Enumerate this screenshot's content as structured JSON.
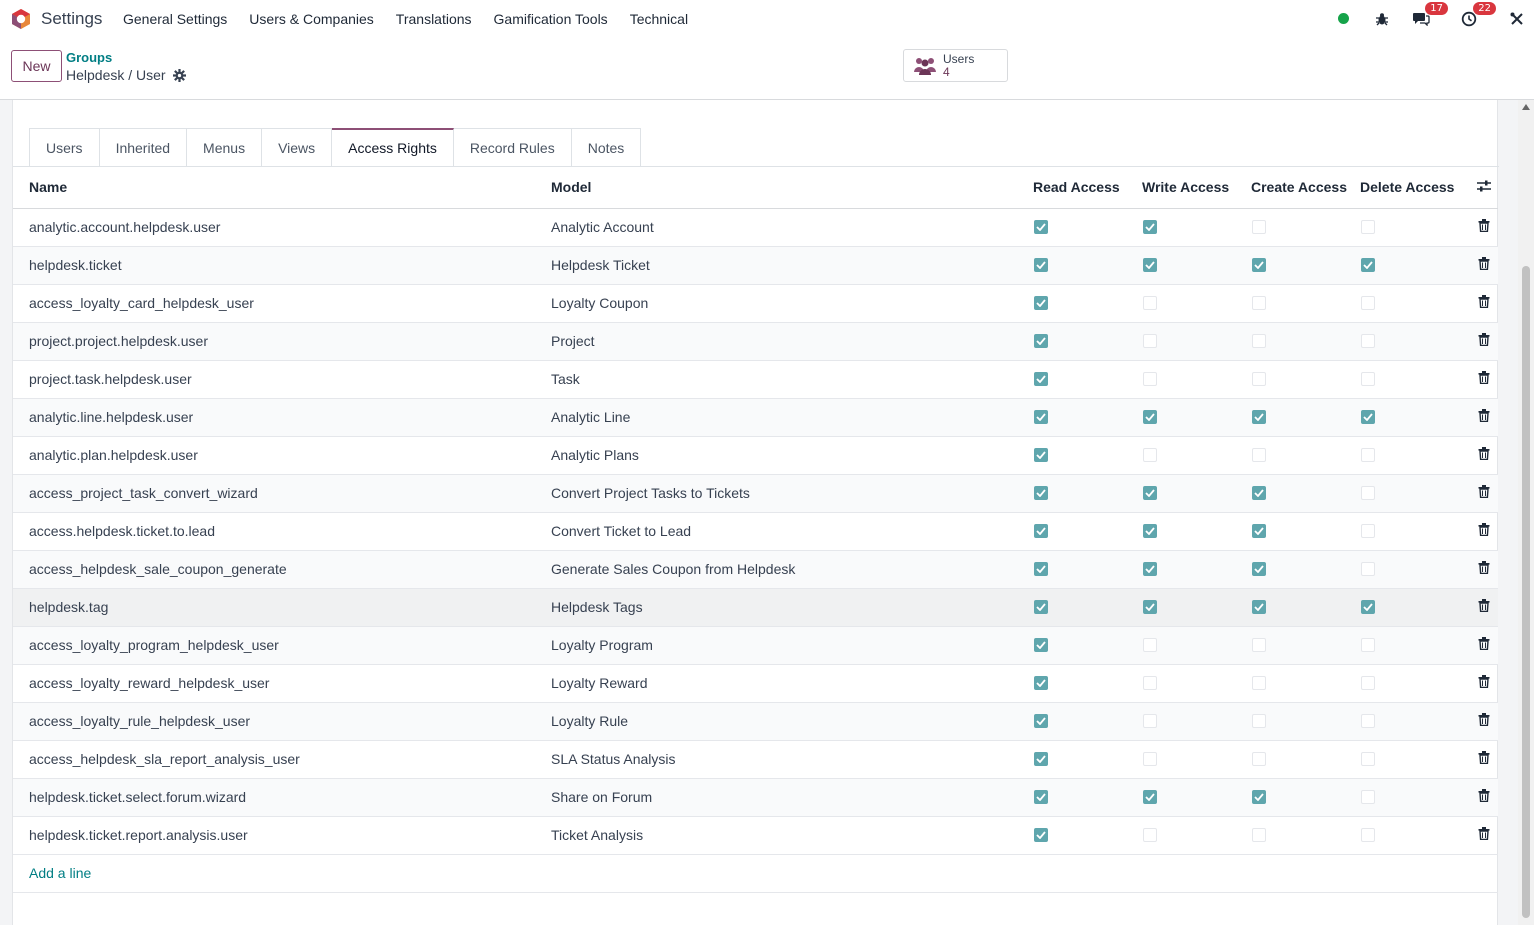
{
  "navbar": {
    "app_name": "Settings",
    "menu": [
      "General Settings",
      "Users & Companies",
      "Translations",
      "Gamification Tools",
      "Technical"
    ],
    "messages_count": "17",
    "activities_count": "22"
  },
  "control_panel": {
    "new_label": "New",
    "breadcrumb_parent": "Groups",
    "breadcrumb_current": "Helpdesk / User",
    "stat_label": "Users",
    "stat_value": "4"
  },
  "tabs": [
    {
      "label": "Users",
      "active": false
    },
    {
      "label": "Inherited",
      "active": false
    },
    {
      "label": "Menus",
      "active": false
    },
    {
      "label": "Views",
      "active": false
    },
    {
      "label": "Access Rights",
      "active": true
    },
    {
      "label": "Record Rules",
      "active": false
    },
    {
      "label": "Notes",
      "active": false
    }
  ],
  "table": {
    "headers": {
      "name": "Name",
      "model": "Model",
      "read": "Read Access",
      "write": "Write Access",
      "create": "Create Access",
      "delete": "Delete Access"
    },
    "rows": [
      {
        "name": "analytic.account.helpdesk.user",
        "model": "Analytic Account",
        "read": true,
        "write": true,
        "create": false,
        "delete": false
      },
      {
        "name": "helpdesk.ticket",
        "model": "Helpdesk Ticket",
        "read": true,
        "write": true,
        "create": true,
        "delete": true
      },
      {
        "name": "access_loyalty_card_helpdesk_user",
        "model": "Loyalty Coupon",
        "read": true,
        "write": false,
        "create": false,
        "delete": false
      },
      {
        "name": "project.project.helpdesk.user",
        "model": "Project",
        "read": true,
        "write": false,
        "create": false,
        "delete": false
      },
      {
        "name": "project.task.helpdesk.user",
        "model": "Task",
        "read": true,
        "write": false,
        "create": false,
        "delete": false
      },
      {
        "name": "analytic.line.helpdesk.user",
        "model": "Analytic Line",
        "read": true,
        "write": true,
        "create": true,
        "delete": true
      },
      {
        "name": "analytic.plan.helpdesk.user",
        "model": "Analytic Plans",
        "read": true,
        "write": false,
        "create": false,
        "delete": false
      },
      {
        "name": "access_project_task_convert_wizard",
        "model": "Convert Project Tasks to Tickets",
        "read": true,
        "write": true,
        "create": true,
        "delete": false
      },
      {
        "name": "access.helpdesk.ticket.to.lead",
        "model": "Convert Ticket to Lead",
        "read": true,
        "write": true,
        "create": true,
        "delete": false
      },
      {
        "name": "access_helpdesk_sale_coupon_generate",
        "model": "Generate Sales Coupon from Helpdesk",
        "read": true,
        "write": true,
        "create": true,
        "delete": false
      },
      {
        "name": "helpdesk.tag",
        "model": "Helpdesk Tags",
        "read": true,
        "write": true,
        "create": true,
        "delete": true
      },
      {
        "name": "access_loyalty_program_helpdesk_user",
        "model": "Loyalty Program",
        "read": true,
        "write": false,
        "create": false,
        "delete": false
      },
      {
        "name": "access_loyalty_reward_helpdesk_user",
        "model": "Loyalty Reward",
        "read": true,
        "write": false,
        "create": false,
        "delete": false
      },
      {
        "name": "access_loyalty_rule_helpdesk_user",
        "model": "Loyalty Rule",
        "read": true,
        "write": false,
        "create": false,
        "delete": false
      },
      {
        "name": "access_helpdesk_sla_report_analysis_user",
        "model": "SLA Status Analysis",
        "read": true,
        "write": false,
        "create": false,
        "delete": false
      },
      {
        "name": "helpdesk.ticket.select.forum.wizard",
        "model": "Share on Forum",
        "read": true,
        "write": true,
        "create": true,
        "delete": false
      },
      {
        "name": "helpdesk.ticket.report.analysis.user",
        "model": "Ticket Analysis",
        "read": true,
        "write": false,
        "create": false,
        "delete": false
      }
    ],
    "add_line": "Add a line"
  }
}
